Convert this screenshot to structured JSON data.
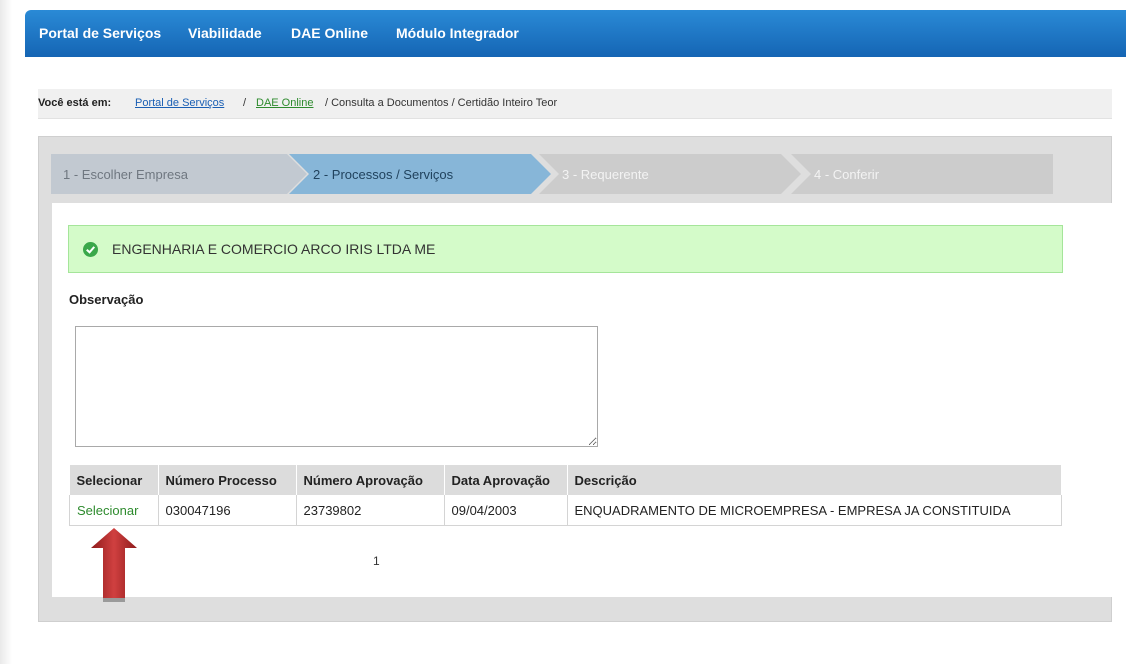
{
  "nav": {
    "items": [
      "Portal de Serviços",
      "Viabilidade",
      "DAE Online",
      "Módulo Integrador"
    ]
  },
  "breadcrumb": {
    "prefix": "Você está em:",
    "link1": "Portal de Serviços",
    "sep1": "/",
    "link2": "DAE Online",
    "rest": "/ Consulta a Documentos / Certidão Inteiro Teor"
  },
  "wizard": {
    "steps": [
      "1 - Escolher Empresa",
      "2 - Processos / Serviços",
      "3 - Requerente",
      "4 - Conferir"
    ],
    "active_step": 2
  },
  "alert": {
    "company": "ENGENHARIA E COMERCIO ARCO IRIS LTDA ME"
  },
  "observacao": {
    "label": "Observação",
    "value": ""
  },
  "table": {
    "headers": [
      "Selecionar",
      "Número Processo",
      "Número Aprovação",
      "Data Aprovação",
      "Descrição"
    ],
    "rows": [
      {
        "select_label": "Selecionar",
        "numero_processo": "030047196",
        "numero_aprovacao": "23739802",
        "data_aprovacao": "09/04/2003",
        "descricao": "ENQUADRAMENTO DE MICROEMPRESA - EMPRESA JA CONSTITUIDA"
      }
    ]
  },
  "pagination": {
    "current_page": "1"
  },
  "colors": {
    "nav_blue": "#1f78c8",
    "alert_green": "#d4fbc9",
    "link_green": "#2e8b2e",
    "annotation_arrow": "#b52a2a"
  },
  "icons": {
    "alert_icon": "check-circle-icon",
    "annotation": "red-up-arrow"
  }
}
